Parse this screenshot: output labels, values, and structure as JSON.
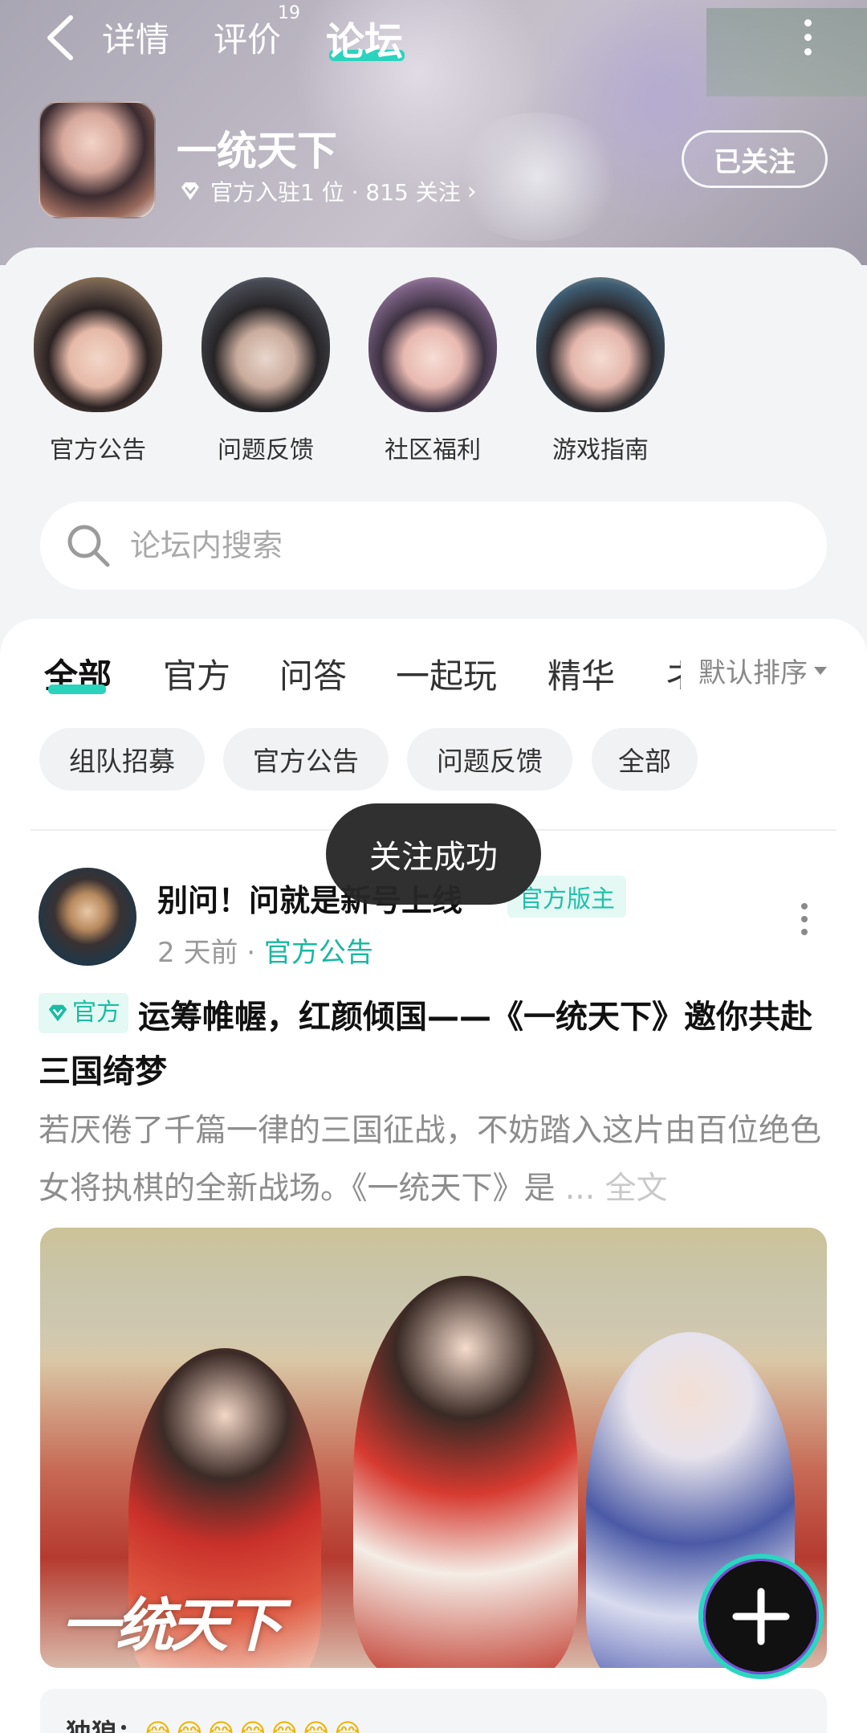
{
  "header": {
    "tabs": [
      {
        "label": "详情"
      },
      {
        "label": "评价",
        "badge": "19"
      },
      {
        "label": "论坛",
        "active": true
      }
    ],
    "game": {
      "title": "一统天下",
      "meta": "官方入驻1 位 · 815 关注",
      "chevron": "›",
      "follow_label": "已关注"
    }
  },
  "categories": [
    {
      "label": "官方公告"
    },
    {
      "label": "问题反馈"
    },
    {
      "label": "社区福利"
    },
    {
      "label": "游戏指南"
    }
  ],
  "search": {
    "placeholder": "论坛内搜索"
  },
  "feed": {
    "tabs": [
      {
        "label": "全部",
        "active": true
      },
      {
        "label": "官方"
      },
      {
        "label": "问答"
      },
      {
        "label": "一起玩"
      },
      {
        "label": "精华"
      },
      {
        "label": "ネ"
      }
    ],
    "sort_label": "默认排序",
    "chips": [
      "组队招募",
      "官方公告",
      "问题反馈",
      "全部"
    ]
  },
  "toast": "关注成功",
  "post": {
    "author": "别问！问就是新号上线",
    "mod_badge": "官方版主",
    "time": "2 天前",
    "separator": " · ",
    "category": "官方公告",
    "official_tag": "官方",
    "title": "运筹帷幄，红颜倾国——《一统天下》邀你共赴三国绮梦",
    "excerpt": "若厌倦了千篇一律的三国征战，不妨踏入这片由百位绝色女将执棋的全新战场。《一统天下》是",
    "ellipsis": " ... ",
    "read_more": "全文",
    "image_logo": "一统天下"
  },
  "comment_preview": {
    "user": "独狼：",
    "emojis": "😂😂😂😂😂😂😂"
  },
  "colors": {
    "accent": "#2ad3bc",
    "accent_text": "#19b89f",
    "toast_bg": "#282828"
  }
}
